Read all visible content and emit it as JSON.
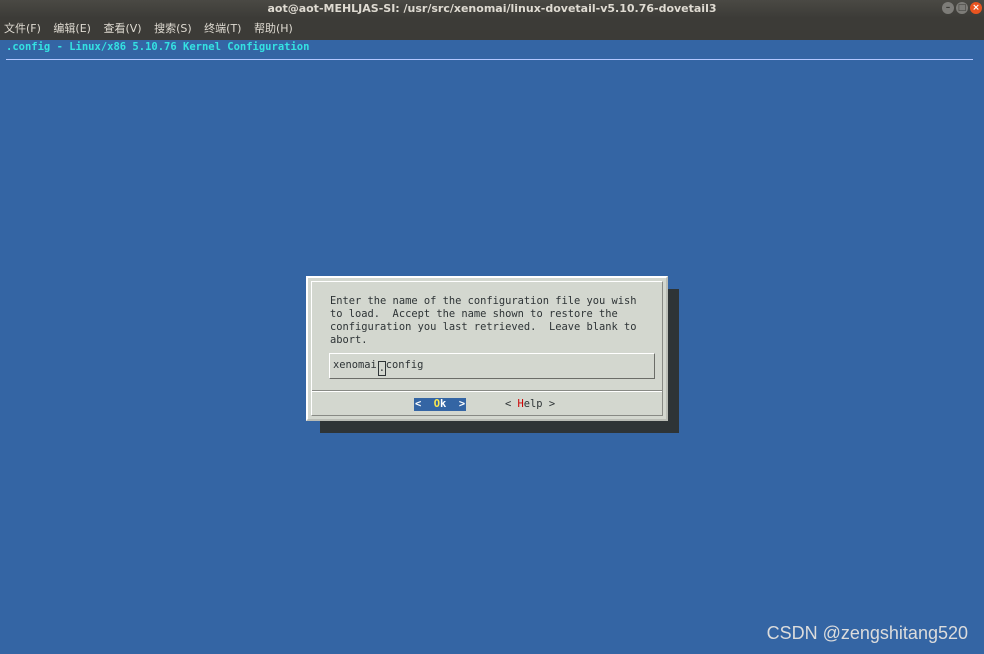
{
  "window": {
    "title": "aot@aot-MEHLJAS-SI: /usr/src/xenomai/linux-dovetail-v5.10.76-dovetail3",
    "controls": [
      "minimize-icon",
      "maximize-icon",
      "close-icon"
    ]
  },
  "menu": [
    {
      "label": "文件(F)"
    },
    {
      "label": "编辑(E)"
    },
    {
      "label": "查看(V)"
    },
    {
      "label": "搜索(S)"
    },
    {
      "label": "终端(T)"
    },
    {
      "label": "帮助(H)"
    }
  ],
  "backtitle": ".config - Linux/x86 5.10.76 Kernel Configuration",
  "dialog": {
    "prompt_lines": [
      "Enter the name of the configuration file you wish",
      "to load.  Accept the name shown to restore the",
      "configuration you last retrieved.  Leave blank to",
      "abort."
    ],
    "input_before_cursor": "xenomai",
    "input_cursor_char": ".",
    "input_after_cursor": "config",
    "ok": {
      "left": "<  ",
      "hot": "O",
      "rest": "k",
      "right": "  >"
    },
    "help": {
      "left": "< ",
      "hot": "H",
      "rest": "elp",
      "right": " >"
    }
  },
  "watermark": "CSDN @zengshitang520",
  "colors": {
    "terminal_bg": "#3465a4",
    "backtitle": "#34e2e2",
    "dialog_bg": "#d3d7cf",
    "shadow": "#2e3436",
    "hotkey_ok": "#fce94f",
    "hotkey_help": "#cc0000"
  }
}
